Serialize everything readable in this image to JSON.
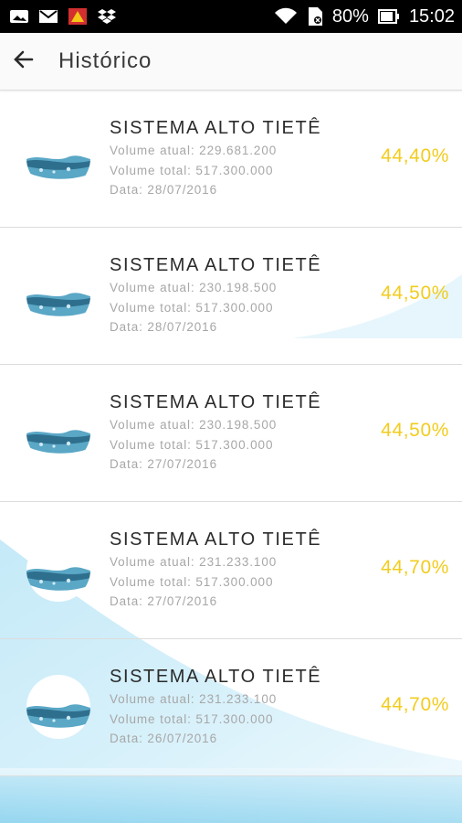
{
  "status_bar": {
    "battery": "80%",
    "time": "15:02"
  },
  "app_bar": {
    "title": "Histórico"
  },
  "colors": {
    "percent": "#f2cc1e",
    "wave": "#5bbfe6"
  },
  "records": [
    {
      "title": "SISTEMA ALTO TIETÊ",
      "volume_atual": "Volume atual: 229.681.200",
      "volume_total": "Volume total: 517.300.000",
      "data": "Data: 28/07/2016",
      "percent": "44,40%"
    },
    {
      "title": "SISTEMA ALTO TIETÊ",
      "volume_atual": "Volume atual: 230.198.500",
      "volume_total": "Volume total: 517.300.000",
      "data": "Data: 28/07/2016",
      "percent": "44,50%"
    },
    {
      "title": "SISTEMA ALTO TIETÊ",
      "volume_atual": "Volume atual: 230.198.500",
      "volume_total": "Volume total: 517.300.000",
      "data": "Data: 27/07/2016",
      "percent": "44,50%"
    },
    {
      "title": "SISTEMA ALTO TIETÊ",
      "volume_atual": "Volume atual: 231.233.100",
      "volume_total": "Volume total: 517.300.000",
      "data": "Data: 27/07/2016",
      "percent": "44,70%"
    },
    {
      "title": "SISTEMA ALTO TIETÊ",
      "volume_atual": "Volume atual: 231.233.100",
      "volume_total": "Volume total: 517.300.000",
      "data": "Data: 26/07/2016",
      "percent": "44,70%"
    }
  ]
}
